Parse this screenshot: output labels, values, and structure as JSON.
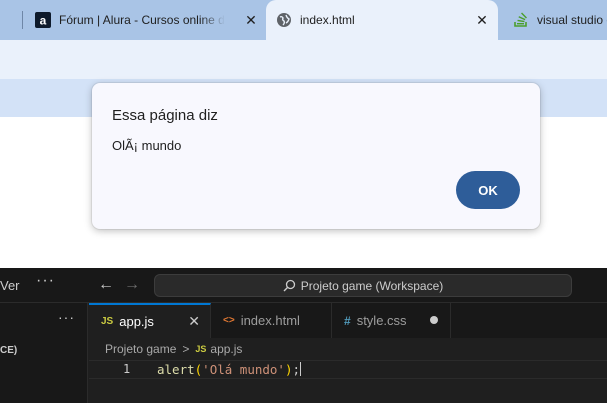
{
  "browser": {
    "tabs": [
      {
        "title": "",
        "icon": "page-icon"
      },
      {
        "title": "Fórum | Alura - Cursos online de",
        "icon": "alura-icon",
        "close": "✕"
      },
      {
        "title": "index.html",
        "icon": "globe-icon",
        "close": "✕",
        "active": true
      },
      {
        "title": "visual studio c",
        "icon": "stackoverflow-icon"
      }
    ]
  },
  "dialog": {
    "title": "Essa página diz",
    "message": "OlÃ¡ mundo",
    "ok_label": "OK"
  },
  "vscode": {
    "menu_label": "Ver",
    "menu_more": "···",
    "command_center": "Projeto game (Workspace)",
    "sidebar_more": "···",
    "sidebar_label": "CE)",
    "editor_tabs": [
      {
        "icon_text": "JS",
        "label": "app.js",
        "active": true,
        "close": "✕"
      },
      {
        "icon_text": "<>",
        "label": "index.html"
      },
      {
        "icon_text": "#",
        "label": "style.css",
        "unsaved": true
      }
    ],
    "breadcrumbs": {
      "folder": "Projeto game",
      "separator": ">",
      "icon_text": "JS",
      "file": "app.js"
    },
    "code": {
      "line_number": "1",
      "fn": "alert",
      "open": "(",
      "str": "'Olá mundo'",
      "close": ")",
      "semi": ";"
    },
    "colors": {
      "background": "#1f1f1f",
      "accent": "#0078d4",
      "js_icon": "#cbcb41",
      "html_icon": "#e37933",
      "css_icon": "#519aba"
    }
  }
}
